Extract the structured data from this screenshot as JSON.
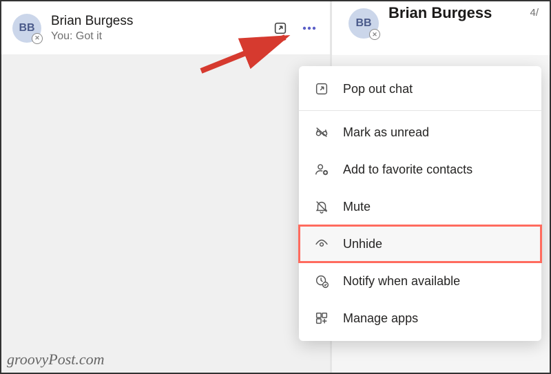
{
  "chat_item": {
    "avatar_initials": "BB",
    "name": "Brian Burgess",
    "preview": "You: Got it"
  },
  "right_pane": {
    "avatar_initials": "BB",
    "name": "Brian Burgess",
    "date_fragment": "4/"
  },
  "menu": {
    "pop_out": "Pop out chat",
    "mark_unread": "Mark as unread",
    "add_favorite": "Add to favorite contacts",
    "mute": "Mute",
    "unhide": "Unhide",
    "notify": "Notify when available",
    "manage_apps": "Manage apps"
  },
  "watermark": "groovyPost.com"
}
